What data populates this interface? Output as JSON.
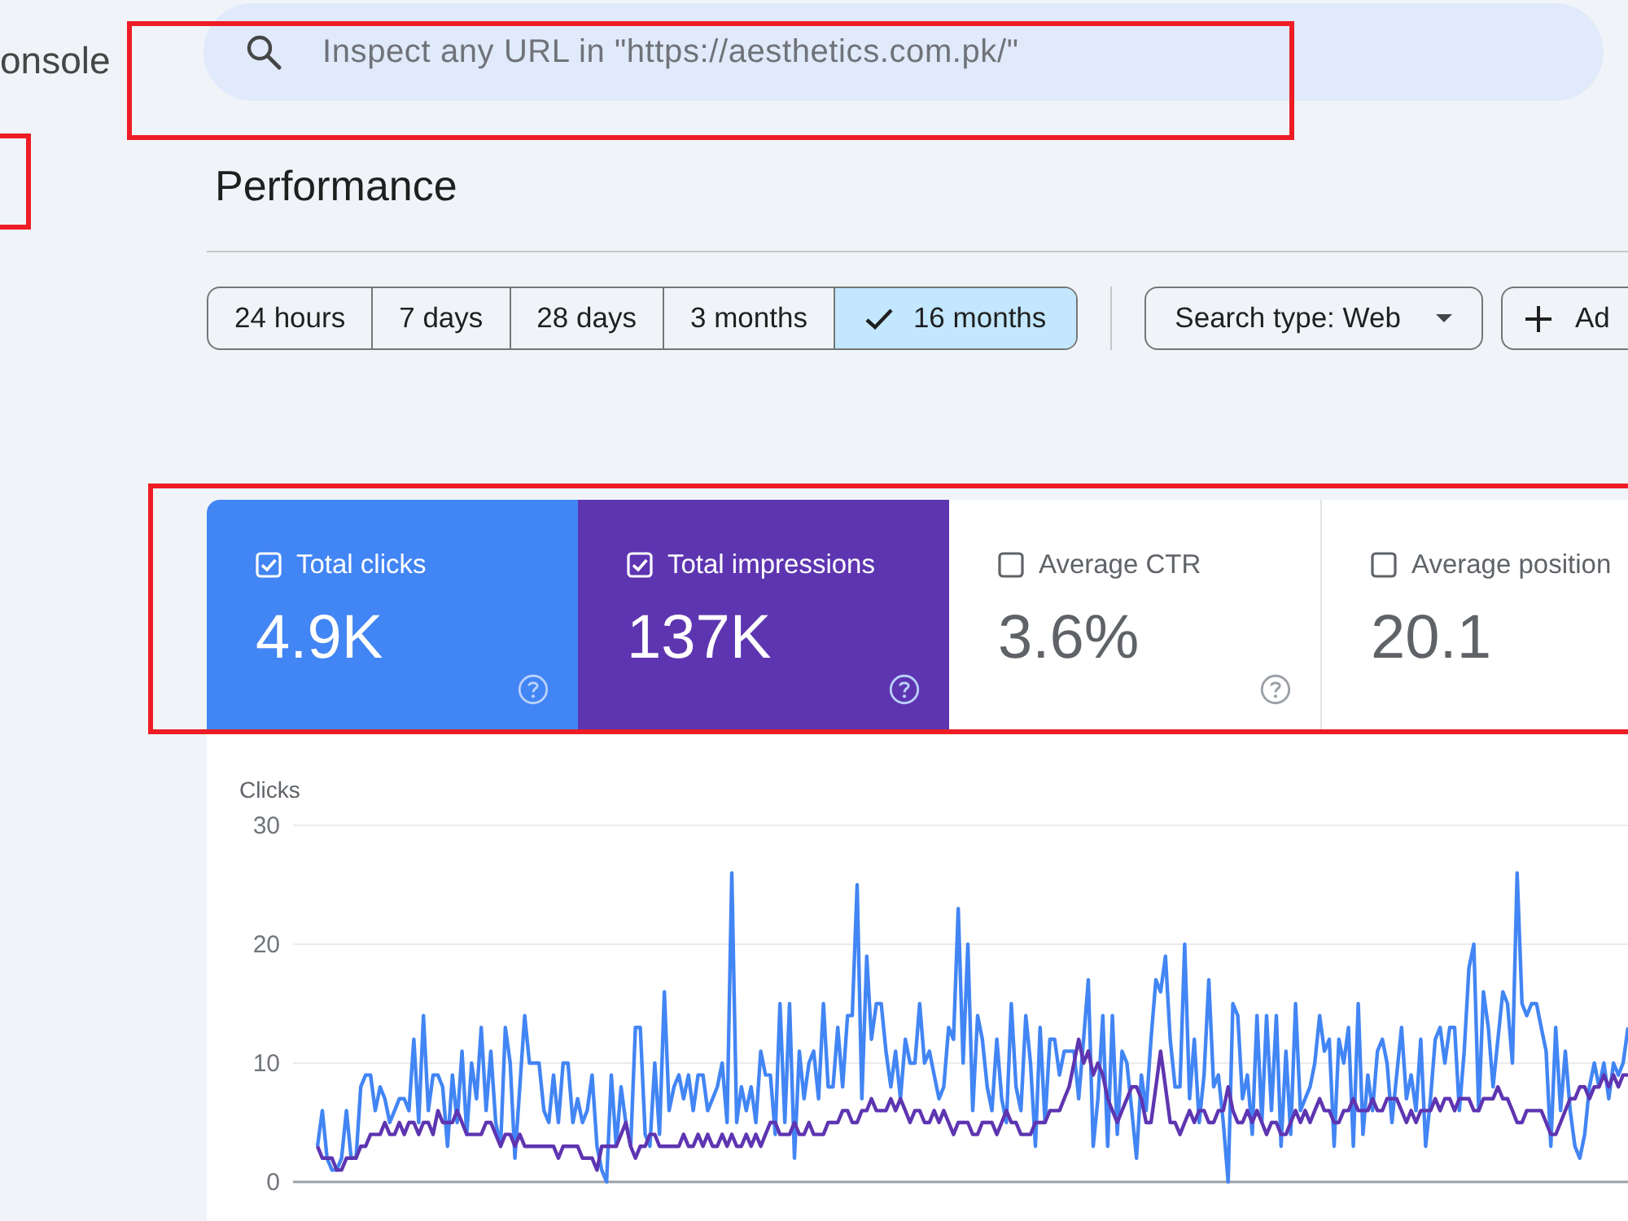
{
  "header": {
    "logo_text": "onsole"
  },
  "sidebar": {
    "highlighted": true
  },
  "search": {
    "placeholder": "Inspect any URL in \"https://aesthetics.com.pk/\"",
    "highlighted": true
  },
  "page_title": "Performance",
  "date_ranges": [
    {
      "label": "24 hours",
      "selected": false
    },
    {
      "label": "7 days",
      "selected": false
    },
    {
      "label": "28 days",
      "selected": false
    },
    {
      "label": "3 months",
      "selected": false
    },
    {
      "label": "16 months",
      "selected": true
    }
  ],
  "filters": [
    {
      "kind": "dropdown",
      "label": "Search type: Web"
    },
    {
      "kind": "add",
      "label": "Ad"
    }
  ],
  "metrics": {
    "highlighted": true,
    "items": [
      {
        "label": "Total clicks",
        "value": "4.9K",
        "checked": true,
        "color": "#4285f4",
        "help": true
      },
      {
        "label": "Total impressions",
        "value": "137K",
        "checked": true,
        "color": "#5e35b1",
        "help": true
      },
      {
        "label": "Average CTR",
        "value": "3.6%",
        "checked": false,
        "help": true
      },
      {
        "label": "Average position",
        "value": "20.1",
        "checked": false,
        "help": false
      }
    ]
  },
  "chart": {
    "chart_data": {
      "type": "line",
      "ylabel": "Clicks",
      "ylim": [
        0,
        30
      ],
      "yticks": [
        0,
        10,
        20,
        30
      ],
      "series": [
        {
          "color": "#4285f4",
          "values": [
            3,
            6,
            2,
            1,
            1,
            2,
            6,
            2,
            2,
            8,
            9,
            9,
            6,
            8,
            7,
            5,
            6,
            7,
            7,
            6,
            12,
            5,
            14,
            6,
            9,
            9,
            8,
            3,
            9,
            5,
            11,
            4,
            10,
            7,
            13,
            6,
            11,
            5,
            3,
            13,
            10,
            2,
            8,
            14,
            10,
            10,
            10,
            6,
            5,
            9,
            5,
            10,
            10,
            5,
            7,
            5,
            6,
            9,
            3,
            1,
            0,
            9,
            3,
            8,
            5,
            3,
            13,
            13,
            4,
            3,
            10,
            4,
            16,
            6,
            8,
            9,
            7,
            9,
            6,
            9,
            9,
            6,
            7,
            8,
            10,
            5,
            26,
            5,
            8,
            6,
            8,
            5,
            11,
            9,
            9,
            4,
            15,
            5,
            15,
            2,
            11,
            7,
            10,
            11,
            7,
            15,
            8,
            8,
            13,
            8,
            14,
            14,
            25,
            7,
            19,
            12,
            15,
            15,
            11,
            8,
            11,
            7,
            12,
            10,
            10,
            15,
            10,
            11,
            9,
            7,
            8,
            13,
            12,
            23,
            10,
            20,
            6,
            14,
            12,
            8,
            6,
            12,
            7,
            5,
            15,
            8,
            6,
            14,
            10,
            3,
            13,
            5,
            12,
            12,
            9,
            11,
            11,
            11,
            7,
            12,
            17,
            3,
            7,
            14,
            3,
            14,
            4,
            11,
            10,
            6,
            2,
            9,
            6,
            12,
            17,
            16,
            19,
            12,
            8,
            8,
            20,
            7,
            12,
            5,
            9,
            17,
            8,
            9,
            5,
            0,
            15,
            14,
            7,
            9,
            4,
            14,
            5,
            14,
            6,
            14,
            3,
            11,
            4,
            15,
            6,
            7,
            8,
            10,
            14,
            11,
            12,
            3,
            12,
            10,
            13,
            3,
            15,
            4,
            9,
            6,
            11,
            12,
            10,
            5,
            9,
            13,
            7,
            9,
            6,
            12,
            3,
            7,
            12,
            13,
            10,
            13,
            13,
            6,
            11,
            18,
            20,
            6,
            16,
            13,
            8,
            12,
            16,
            15,
            10,
            26,
            15,
            14,
            15,
            15,
            13,
            11,
            3,
            13,
            6,
            11,
            6,
            3,
            2,
            4,
            8,
            10,
            8,
            10,
            7,
            10,
            9,
            10,
            13
          ]
        },
        {
          "color": "#5e35b1",
          "values": [
            3,
            2,
            2,
            2,
            1,
            1,
            2,
            2,
            2,
            3,
            3,
            4,
            4,
            4,
            5,
            4,
            4,
            5,
            4,
            5,
            5,
            4,
            5,
            5,
            4,
            6,
            5,
            5,
            5,
            6,
            5,
            4,
            4,
            4,
            4,
            5,
            5,
            4,
            3,
            4,
            4,
            3,
            4,
            3,
            3,
            3,
            3,
            3,
            3,
            3,
            2,
            3,
            3,
            3,
            3,
            2,
            2,
            2,
            1,
            3,
            3,
            3,
            3,
            4,
            5,
            3,
            2,
            3,
            3,
            4,
            4,
            3,
            3,
            3,
            3,
            3,
            4,
            3,
            3,
            4,
            3,
            4,
            3,
            3,
            4,
            3,
            4,
            3,
            3,
            4,
            3,
            4,
            3,
            4,
            5,
            5,
            4,
            4,
            4,
            5,
            4,
            4,
            5,
            4,
            4,
            4,
            5,
            5,
            5,
            6,
            6,
            5,
            5,
            6,
            6,
            7,
            6,
            6,
            6,
            7,
            6,
            7,
            6,
            5,
            6,
            6,
            5,
            5,
            6,
            5,
            6,
            5,
            4,
            5,
            5,
            5,
            4,
            4,
            5,
            5,
            5,
            4,
            5,
            6,
            5,
            5,
            4,
            4,
            4,
            5,
            5,
            5,
            6,
            6,
            6,
            7,
            8,
            10,
            12,
            10,
            11,
            9,
            10,
            9,
            7,
            6,
            5,
            6,
            7,
            8,
            8,
            7,
            5,
            5,
            8,
            11,
            8,
            5,
            5,
            4,
            5,
            6,
            5,
            6,
            6,
            5,
            5,
            6,
            6,
            8,
            6,
            5,
            5,
            6,
            5,
            6,
            5,
            4,
            5,
            5,
            4,
            4,
            5,
            6,
            5,
            6,
            5,
            6,
            7,
            6,
            6,
            5,
            5,
            6,
            6,
            7,
            6,
            6,
            6,
            7,
            6,
            6,
            7,
            7,
            7,
            6,
            5,
            6,
            5,
            6,
            6,
            6,
            7,
            6,
            7,
            7,
            6,
            7,
            7,
            7,
            6,
            6,
            7,
            7,
            7,
            8,
            7,
            7,
            6,
            5,
            5,
            6,
            6,
            6,
            6,
            5,
            4,
            4,
            5,
            6,
            7,
            7,
            8,
            8,
            7,
            8,
            8,
            9,
            8,
            9,
            8,
            9,
            9
          ]
        }
      ]
    }
  }
}
